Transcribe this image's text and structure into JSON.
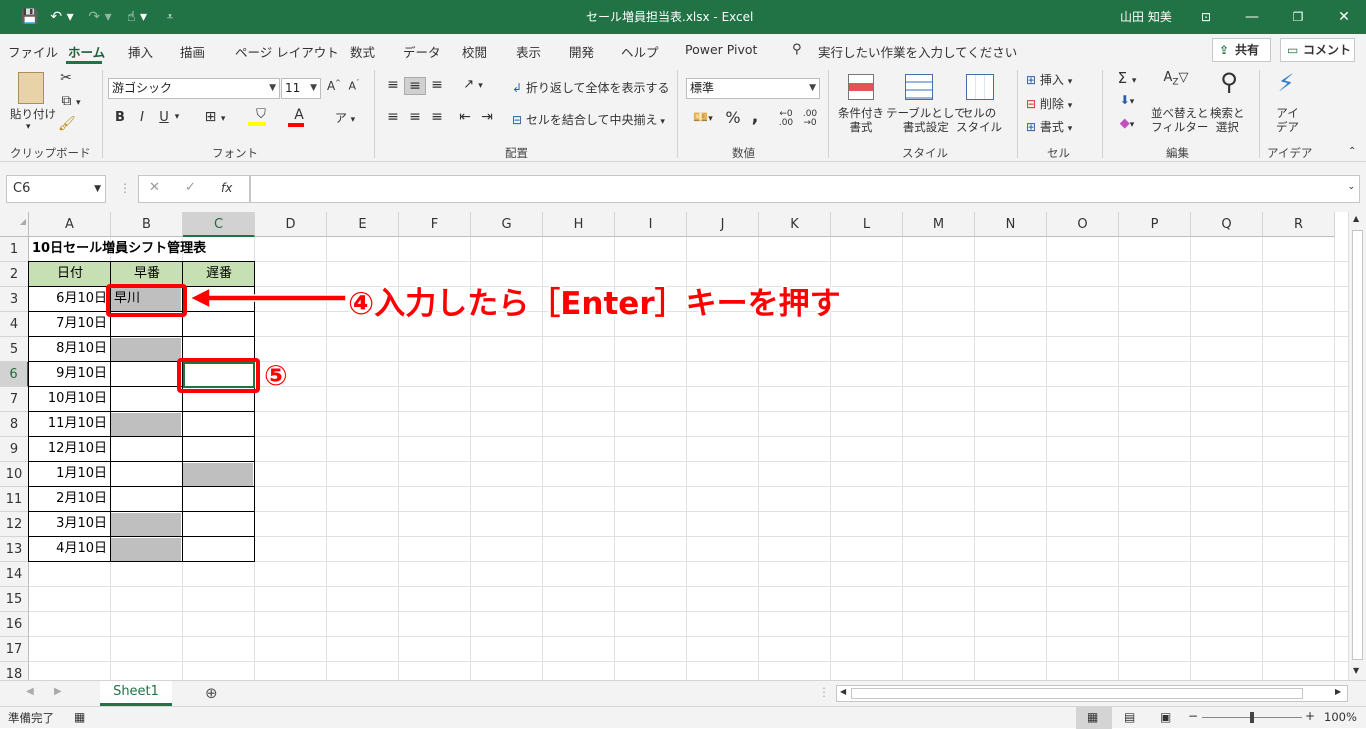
{
  "window": {
    "title": "セール増員担当表.xlsx  -  Excel",
    "user": "山田 知美"
  },
  "menu": {
    "items": [
      "ファイル",
      "ホーム",
      "挿入",
      "描画",
      "ページ レイアウト",
      "数式",
      "データ",
      "校閲",
      "表示",
      "開発",
      "ヘルプ",
      "Power Pivot"
    ],
    "search": "実行したい作業を入力してください",
    "share": "共有",
    "comment": "コメント"
  },
  "ribbon": {
    "clipboard": {
      "paste": "貼り付け",
      "label": "クリップボード"
    },
    "font": {
      "name": "游ゴシック",
      "size": "11",
      "label": "フォント",
      "bold": "B",
      "italic": "I",
      "underline": "U"
    },
    "alignment": {
      "wrap": "折り返して全体を表示する",
      "merge": "セルを結合して中央揃え",
      "label": "配置"
    },
    "number": {
      "format": "標準",
      "label": "数値",
      "percent": "%",
      "comma": ","
    },
    "styles": {
      "conditional": "条件付き\n書式",
      "table": "テーブルとして\n書式設定",
      "cellstyle": "セルの\nスタイル",
      "label": "スタイル"
    },
    "cells": {
      "insert": "挿入",
      "delete": "削除",
      "format": "書式",
      "label": "セル"
    },
    "editing": {
      "sort": "並べ替えと\nフィルター",
      "find": "検索と\n選択",
      "label": "編集"
    },
    "ideas": {
      "btn": "アイ\nデア",
      "label": "アイデア"
    }
  },
  "formula": {
    "namebox": "C6",
    "fx": "fx",
    "value": ""
  },
  "columns": [
    "A",
    "B",
    "C",
    "D",
    "E",
    "F",
    "G",
    "H",
    "I",
    "J",
    "K",
    "L",
    "M",
    "N",
    "O",
    "P",
    "Q",
    "R"
  ],
  "rows": [
    "1",
    "2",
    "3",
    "4",
    "5",
    "6",
    "7",
    "8",
    "9",
    "10",
    "11",
    "12",
    "13",
    "14",
    "15",
    "16",
    "17",
    "18"
  ],
  "sheet": {
    "title": "10日セール増員シフト管理表",
    "headers": [
      "日付",
      "早番",
      "遅番"
    ],
    "dates": [
      "6月10日",
      "7月10日",
      "8月10日",
      "9月10日",
      "10月10日",
      "11月10日",
      "12月10日",
      "1月10日",
      "2月10日",
      "3月10日",
      "4月10日"
    ],
    "b3": "早川"
  },
  "annotations": {
    "step4": "④入力したら［Enter］キーを押す",
    "step5": "⑤"
  },
  "tabs": {
    "sheet1": "Sheet1"
  },
  "status": {
    "ready": "準備完了",
    "zoom": "100%"
  },
  "colors": {
    "excel_green": "#217346",
    "header_fill": "#c6e0b4",
    "blocked_fill": "#bfbfbf",
    "annotation": "#ff0000"
  }
}
